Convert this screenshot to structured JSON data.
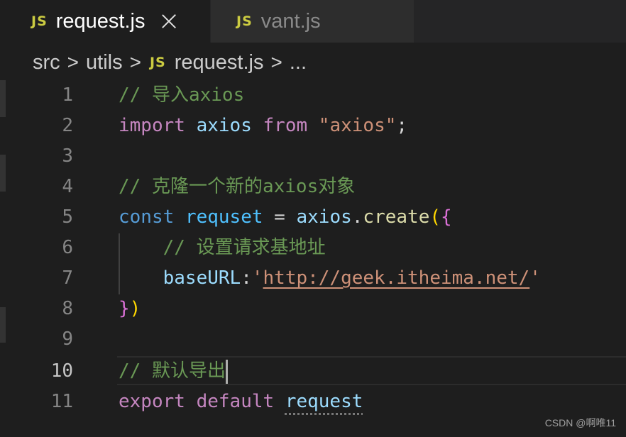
{
  "tabs": [
    {
      "icon": "JS",
      "label": "request.js",
      "active": true
    },
    {
      "icon": "JS",
      "label": "vant.js",
      "active": false
    }
  ],
  "breadcrumb": {
    "items": [
      "src",
      "utils",
      "request.js",
      "..."
    ],
    "separator": ">",
    "file_icon": "JS"
  },
  "editor": {
    "current_line": 10,
    "lines": [
      {
        "no": "1",
        "tokens": [
          "// 导入axios"
        ]
      },
      {
        "no": "2",
        "tokens": [
          "import",
          " ",
          "axios",
          " ",
          "from",
          " ",
          "\"axios\"",
          ";"
        ]
      },
      {
        "no": "3",
        "tokens": []
      },
      {
        "no": "4",
        "tokens": [
          "// 克隆一个新的axios对象"
        ]
      },
      {
        "no": "5",
        "tokens": [
          "const",
          " ",
          "requset",
          " = ",
          "axios",
          ".",
          "create",
          "(",
          "{"
        ]
      },
      {
        "no": "6",
        "tokens": [
          "    ",
          "// 设置请求基地址"
        ]
      },
      {
        "no": "7",
        "tokens": [
          "    ",
          "baseURL",
          ":",
          "'",
          "http://geek.itheima.net/",
          "'"
        ]
      },
      {
        "no": "8",
        "tokens": [
          "}",
          ")"
        ]
      },
      {
        "no": "9",
        "tokens": []
      },
      {
        "no": "10",
        "tokens": [
          "// 默认导出"
        ]
      },
      {
        "no": "11",
        "tokens": [
          "export",
          " ",
          "default",
          " ",
          "request"
        ]
      }
    ]
  },
  "watermark": "CSDN @啊唯11",
  "colors": {
    "comment": "#6a9955",
    "keyword": "#c586c0",
    "declaration": "#569cd6",
    "variable": "#9cdcfe",
    "string": "#ce9178",
    "function": "#dcdcaa",
    "js_icon": "#cbcb41"
  }
}
